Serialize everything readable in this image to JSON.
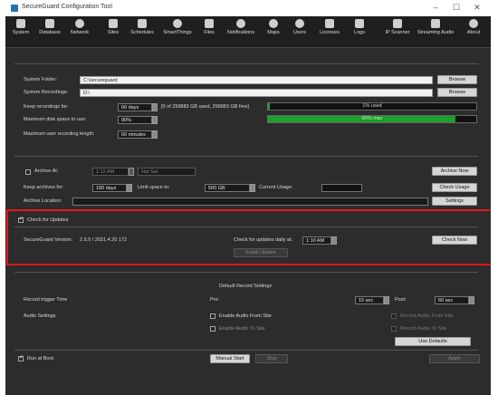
{
  "window": {
    "title": "SecureGuard Configuration Tool",
    "controls": [
      "–",
      "☐",
      "✕"
    ]
  },
  "toolbar": [
    {
      "label": "System",
      "icon": "system-icon"
    },
    {
      "label": "Database",
      "icon": "database-icon"
    },
    {
      "label": "Network",
      "icon": "network-icon"
    },
    {
      "label": "Sites",
      "icon": "sites-icon"
    },
    {
      "label": "Schedules",
      "icon": "schedules-icon"
    },
    {
      "label": "SmartThings",
      "icon": "smartthings-icon"
    },
    {
      "label": "Files",
      "icon": "files-icon"
    },
    {
      "label": "Notifications",
      "icon": "notifications-icon"
    },
    {
      "label": "Maps",
      "icon": "maps-icon"
    },
    {
      "label": "Users",
      "icon": "users-icon"
    },
    {
      "label": "Licenses",
      "icon": "licenses-icon"
    },
    {
      "label": "Logs",
      "icon": "logs-icon"
    },
    {
      "label": "IP Scanner",
      "icon": "ip-scanner-icon"
    },
    {
      "label": "Streaming Audio",
      "icon": "streaming-audio-icon"
    },
    {
      "label": "About",
      "icon": "about-icon"
    }
  ],
  "storage": {
    "system_folder_label": "System Folder:",
    "system_folder_value": "C:\\secureguard",
    "system_recordings_label": "System Recordings:",
    "system_recordings_value": "D:\\",
    "browse_label": "Browse",
    "keep_recordings_label": "Keep recordings for:",
    "keep_recordings_value": "60 days",
    "usage_text": "[0 of 299883 GB used, 299883 GB free]",
    "usage_bar_text": "1% used",
    "usage_fraction": 0.01,
    "max_disk_label": "Maximum disk space to use:",
    "max_disk_value": "90%",
    "max_disk_bar_text": "90% max",
    "max_disk_fraction": 0.9,
    "max_user_rec_label": "Maximum user recording length:",
    "max_user_rec_value": "60 minutes"
  },
  "archive": {
    "archive_at_label": "Archive At:",
    "archive_at_time": "1:12 AM",
    "archive_at_option": "Not Set",
    "archive_now_label": "Archive Now",
    "keep_archives_label": "Keep archives for:",
    "keep_archives_value": "180 days",
    "limit_space_label": "Limit space to:",
    "limit_space_value": "500 GB",
    "current_usage_label": "Current Usage:",
    "current_usage_value": "",
    "check_usage_label": "Check Usage",
    "archive_location_label": "Archive Location:",
    "archive_location_value": "",
    "settings_label": "Settings"
  },
  "updates": {
    "check_for_updates_label": "Check for Updates",
    "version_label": "SecureGuard Version:",
    "version_value": "2.5.0 / 2021.4.20 172",
    "check_daily_label": "Check for updates daily at:",
    "check_daily_time": "1:10 AM",
    "check_now_label": "Check Now",
    "install_update_label": "Install Update"
  },
  "default_record": {
    "section_title": "Default Record Settings",
    "trigger_time_label": "Record trigger Time",
    "pre_label": "Pre:",
    "pre_value": "15 sec",
    "post_label": "Post:",
    "post_value": "60 sec",
    "audio_settings_label": "Audio Settings",
    "enable_audio_from_site": "Enable Audio From Site",
    "enable_audio_to_site": "Enable Audio To Site",
    "record_audio_from_site": "Record Audio From Site",
    "record_audio_to_site": "Record Audio To Site",
    "use_defaults_label": "Use Defaults"
  },
  "footer": {
    "run_at_boot_label": "Run at Boot",
    "manual_start_label": "Manual Start",
    "stop_label": "Stop",
    "apply_label": "Apply"
  },
  "colors": {
    "highlight": "#e3141b",
    "disk_bar_green": "#1e9e2a"
  }
}
